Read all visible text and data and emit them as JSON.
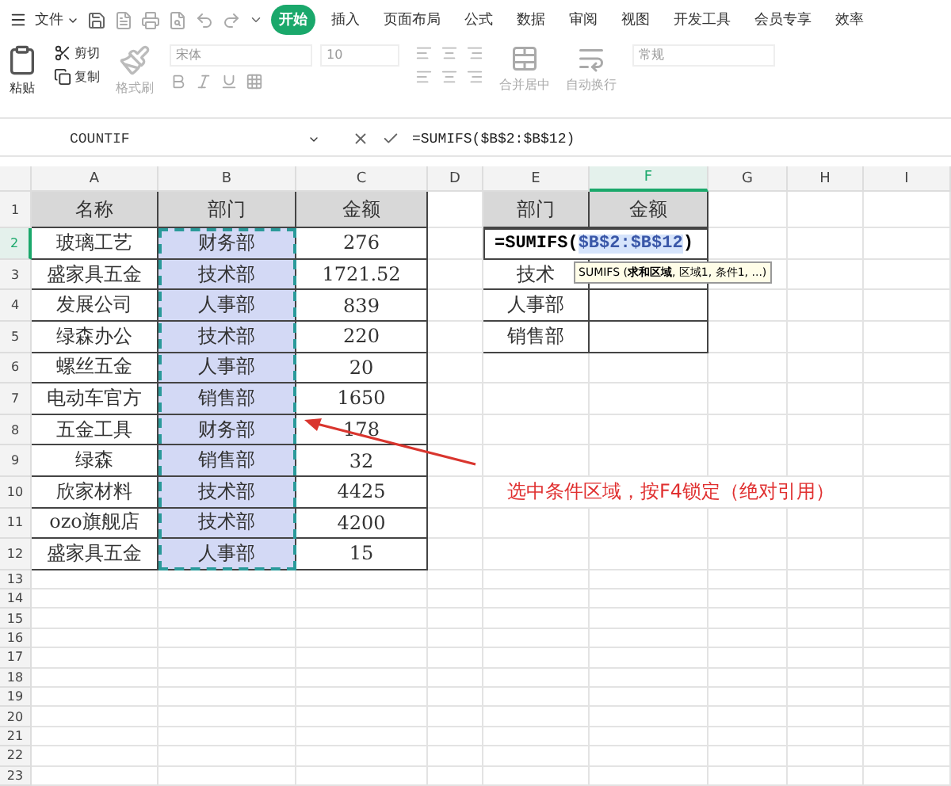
{
  "menu": {
    "file": "文件",
    "tabs": [
      {
        "label": "开始",
        "selected": true
      },
      {
        "label": "插入",
        "selected": false
      },
      {
        "label": "页面布局",
        "selected": false
      },
      {
        "label": "公式",
        "selected": false
      },
      {
        "label": "数据",
        "selected": false
      },
      {
        "label": "审阅",
        "selected": false
      },
      {
        "label": "视图",
        "selected": false
      },
      {
        "label": "开发工具",
        "selected": false
      },
      {
        "label": "会员专享",
        "selected": false
      },
      {
        "label": "效率",
        "selected": false
      }
    ]
  },
  "ribbon": {
    "paste": "粘贴",
    "cut": "剪切",
    "copy": "复制",
    "format_painter": "格式刷",
    "font": "宋体",
    "font_size": "10",
    "merge": "合并居中",
    "wrap": "自动换行",
    "number_format": "常规"
  },
  "formula_bar": {
    "name_box": "COUNTIF",
    "formula": "=SUMIFS($B$2:$B$12)"
  },
  "sheet": {
    "columns": [
      {
        "label": "A",
        "active": false
      },
      {
        "label": "B",
        "active": false
      },
      {
        "label": "C",
        "active": false
      },
      {
        "label": "D",
        "active": false
      },
      {
        "label": "E",
        "active": false
      },
      {
        "label": "F",
        "active": true
      },
      {
        "label": "G",
        "active": false
      },
      {
        "label": "H",
        "active": false
      },
      {
        "label": "I",
        "active": false
      }
    ],
    "rows": [
      {
        "label": "1",
        "active": false
      },
      {
        "label": "2",
        "active": true
      },
      {
        "label": "3",
        "active": false
      },
      {
        "label": "4",
        "active": false
      },
      {
        "label": "5",
        "active": false
      },
      {
        "label": "6",
        "active": false
      },
      {
        "label": "7",
        "active": false
      },
      {
        "label": "8",
        "active": false
      },
      {
        "label": "9",
        "active": false
      },
      {
        "label": "10",
        "active": false
      },
      {
        "label": "11",
        "active": false
      },
      {
        "label": "12",
        "active": false
      },
      {
        "label": "13",
        "active": false
      },
      {
        "label": "14",
        "active": false
      },
      {
        "label": "15",
        "active": false
      },
      {
        "label": "16",
        "active": false
      },
      {
        "label": "17",
        "active": false
      },
      {
        "label": "18",
        "active": false
      },
      {
        "label": "19",
        "active": false
      },
      {
        "label": "20",
        "active": false
      },
      {
        "label": "21",
        "active": false
      },
      {
        "label": "22",
        "active": false
      },
      {
        "label": "23",
        "active": false
      }
    ],
    "data_table": {
      "columns": [
        {
          "label": "名称",
          "selected": false
        },
        {
          "label": "部门",
          "selected": true
        },
        {
          "label": "金额",
          "selected": false
        }
      ],
      "rows": [
        [
          "玻璃工艺",
          "财务部",
          "276"
        ],
        [
          "盛家具五金",
          "技术部",
          "1721.52"
        ],
        [
          "发展公司",
          "人事部",
          "839"
        ],
        [
          "绿森办公",
          "技术部",
          "220"
        ],
        [
          "螺丝五金",
          "人事部",
          "20"
        ],
        [
          "电动车官方",
          "销售部",
          "1650"
        ],
        [
          "五金工具",
          "财务部",
          "178"
        ],
        [
          "绿森",
          "销售部",
          "32"
        ],
        [
          "欣家材料",
          "技术部",
          "4425"
        ],
        [
          "ozo旗舰店",
          "技术部",
          "4200"
        ],
        [
          "盛家具五金",
          "人事部",
          "15"
        ]
      ]
    },
    "summary_table": {
      "columns": [
        "部门",
        "金额"
      ],
      "rows": [
        [
          "技术"
        ],
        [
          "人事部"
        ],
        [
          "销售部"
        ]
      ]
    },
    "editor": {
      "prefix": "=SUMIFS(",
      "range": "$B$2:$B$12",
      "suffix": ")"
    },
    "tooltip": "SUMIFS (**求和区域**, 区域1, 条件1, ...)",
    "annotation": "选中条件区域，按F4锁定（绝对引用）"
  }
}
